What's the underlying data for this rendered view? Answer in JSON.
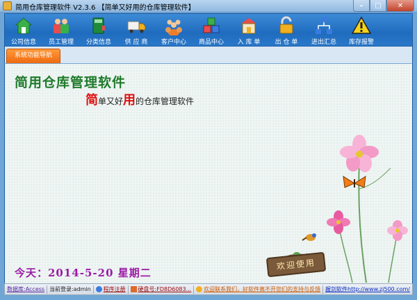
{
  "window": {
    "title": "简用仓库管理软件  V2.3.6 【简单又好用的仓库管理软件】",
    "buttons": {
      "minimize": "–",
      "maximize": "□",
      "close": "✕"
    }
  },
  "toolbar": {
    "items": [
      {
        "label": "公司信息",
        "icon": "house-icon"
      },
      {
        "label": "员工管理",
        "icon": "employees-icon"
      },
      {
        "label": "分类信息",
        "icon": "book-icon"
      },
      {
        "label": "供 应 商",
        "icon": "truck-icon"
      },
      {
        "label": "客户中心",
        "icon": "customers-icon"
      },
      {
        "label": "商品中心",
        "icon": "cubes-icon"
      },
      {
        "label": "入 库 单",
        "icon": "warehouse-in-icon"
      },
      {
        "label": "出 仓 单",
        "icon": "lock-icon"
      },
      {
        "label": "进出汇总",
        "icon": "network-icon"
      },
      {
        "label": "库存报警",
        "icon": "warning-icon"
      }
    ]
  },
  "tabs": {
    "nav": "系统功能导航"
  },
  "main": {
    "heading": "简用仓库管理软件",
    "slogan": {
      "c1": "简",
      "t1": "单又好",
      "c2": "用",
      "t2": "的仓库管理软件"
    },
    "today": "今天：2014-5-20  星期二",
    "welcome": "欢迎使用"
  },
  "status": {
    "db": "数据库:Access",
    "login": "当前登录:admin",
    "register": "程序注册",
    "disk": "硬盘号:FD8D6083...",
    "contact": "欢迎联系我们，好软件离不开您们的支持与反馈",
    "site": "握剑软件http://www.zj500.com/"
  },
  "colors": {
    "toolbar": "#1f6cbf",
    "tab": "#ee6a10",
    "heading": "#1f7a2a",
    "slogan_accent": "#e01010",
    "date": "#9b1ba6"
  }
}
